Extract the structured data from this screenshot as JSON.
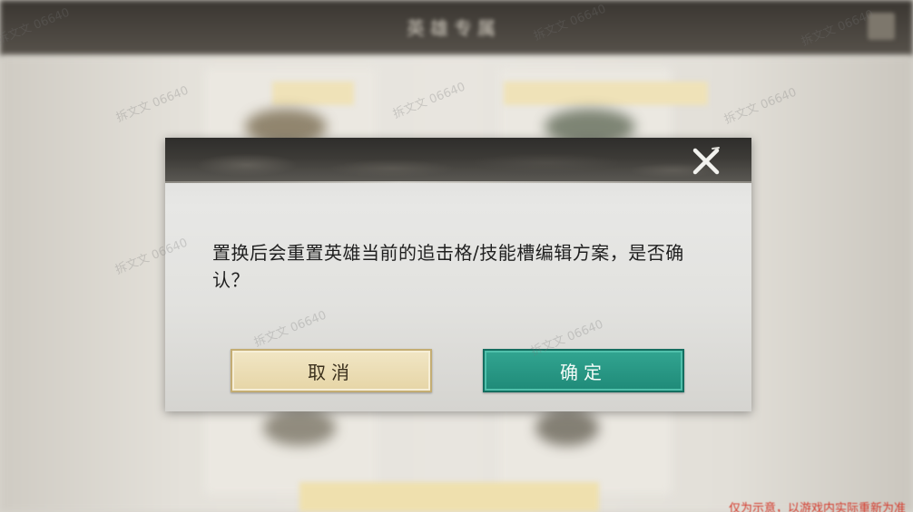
{
  "background": {
    "title": "英雄专属"
  },
  "dialog": {
    "message": "置换后会重置英雄当前的追击格/技能槽编辑方案，是否确认？",
    "close_icon": "close-icon",
    "cancel_label": "取消",
    "confirm_label": "确定"
  },
  "watermark": {
    "text": "拆文文 06640"
  },
  "footer_note": "仅为示意，以游戏内实际重新为准",
  "colors": {
    "confirm": "#1f8a78",
    "cancel": "#e6d5a6",
    "header": "#3d3b37",
    "footer_note": "#d43a2c"
  }
}
